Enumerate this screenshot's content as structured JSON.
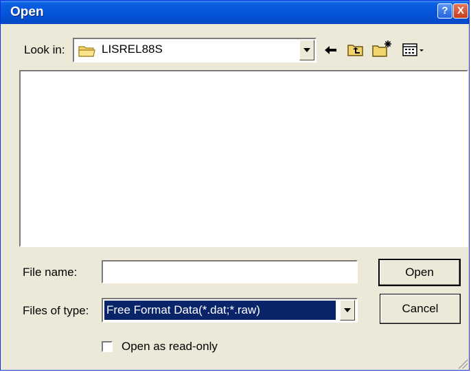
{
  "window": {
    "title": "Open",
    "help_label": "?",
    "close_label": "X"
  },
  "look_in": {
    "label": "Look in:",
    "folder": "LISREL88S",
    "folder_icon": "folder-icon"
  },
  "toolbar": {
    "icons": [
      "back-arrow-icon",
      "up-one-level-icon",
      "create-new-folder-icon",
      "view-menu-icon"
    ]
  },
  "file_list": {
    "items": []
  },
  "file_name": {
    "label": "File name:",
    "value": ""
  },
  "files_of_type": {
    "label": "Files of type:",
    "value": "Free Format Data(*.dat;*.raw)"
  },
  "buttons": {
    "open": "Open",
    "cancel": "Cancel"
  },
  "read_only": {
    "label": "Open as read-only",
    "checked": false
  },
  "colors": {
    "title_bar": "#0553d8",
    "selection": "#0a246a",
    "dialog_bg": "#ece9d8"
  }
}
